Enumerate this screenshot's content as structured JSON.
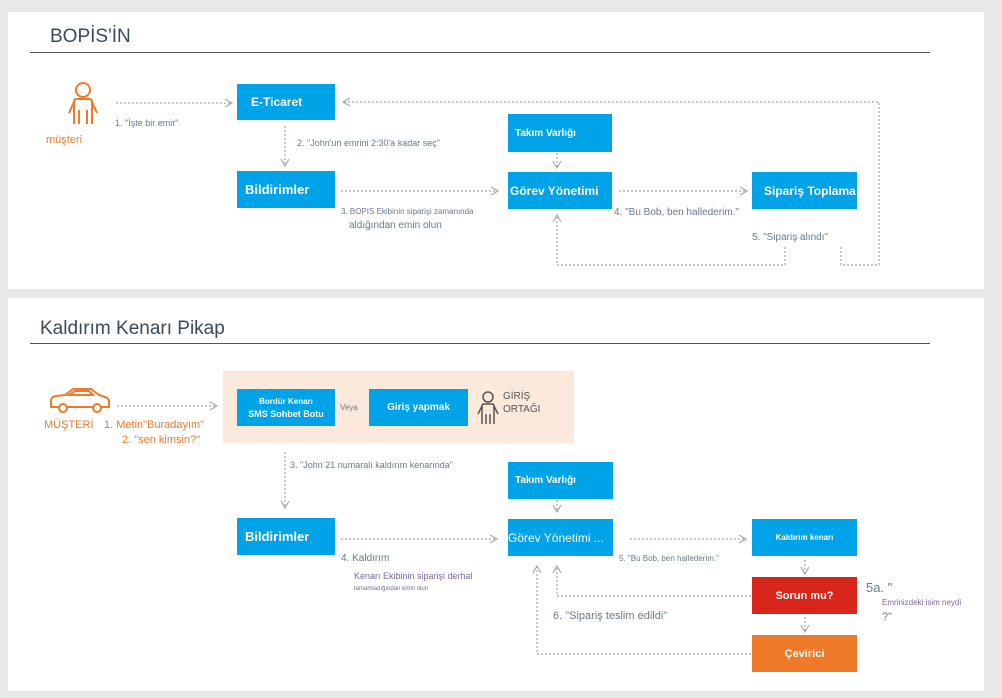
{
  "top": {
    "title": "BOPİS'İN",
    "customer_label": "müşteri",
    "boxes": {
      "eticaret": "E-Ticaret",
      "bildirimler": "Bildirimler",
      "takim": "Takım Varlığı",
      "gorev": "Görev Yönetimi",
      "siparis_toplama": "Sipariş Toplama"
    },
    "labels": {
      "l1": "1. \"İşte bir emir\"",
      "l2": "2. \"John'un emrini 2:30'a kadar seç\"",
      "l3a": "3. BOPIS Ekibinin siparişi zamanında",
      "l3b": "aldığından emin olun",
      "l4": "4. \"Bu Bob, ben hallederim.\"",
      "l5": "5. \"Sipariş alındı\""
    }
  },
  "bottom": {
    "title": "Kaldırım Kenarı Pikap",
    "customer_label": "MÜŞTERİ",
    "partner_label_1": "GİRİŞ",
    "partner_label_2": "ORTAĞI",
    "boxes": {
      "sms_1": "Bordür Kenarı",
      "sms_2": "SMS Sohbet Botu",
      "veya": "Veya",
      "giris": "Giriş yapmak",
      "takim": "Takım Varlığı",
      "bildirimler": "Bildirimler",
      "gorev": "Görev Yönetimi ...",
      "kaldirim": "Kaldırım kenarı",
      "sorun": "Sorun mu?",
      "cevirici": "Çevirici"
    },
    "labels": {
      "l1": "1. Metin\"Buradayım\"",
      "l2": "2. \"sen kimsin?\"",
      "l3": "3. \"John 21 numaralı kaldırım kenarında\"",
      "l4a": "4. Kaldırım",
      "l4b": "Kenarı Ekibinin siparişi derhal",
      "l4c": "tamamladığından emin olun",
      "l5": "5. \"Bu Bob, ben hallederim.\"",
      "l5a_1": "5a. \"",
      "l5a_2": "Emrinizdeki isim neydi",
      "l5a_3": "?\"",
      "l6": "6. \"Sipariş teslim edildi\""
    }
  },
  "colors": {
    "blue": "#00a3e8",
    "orange": "#ee7a2a",
    "red": "#d9261c",
    "beige": "#fbe9dc",
    "connector": "#a8a8a8"
  }
}
